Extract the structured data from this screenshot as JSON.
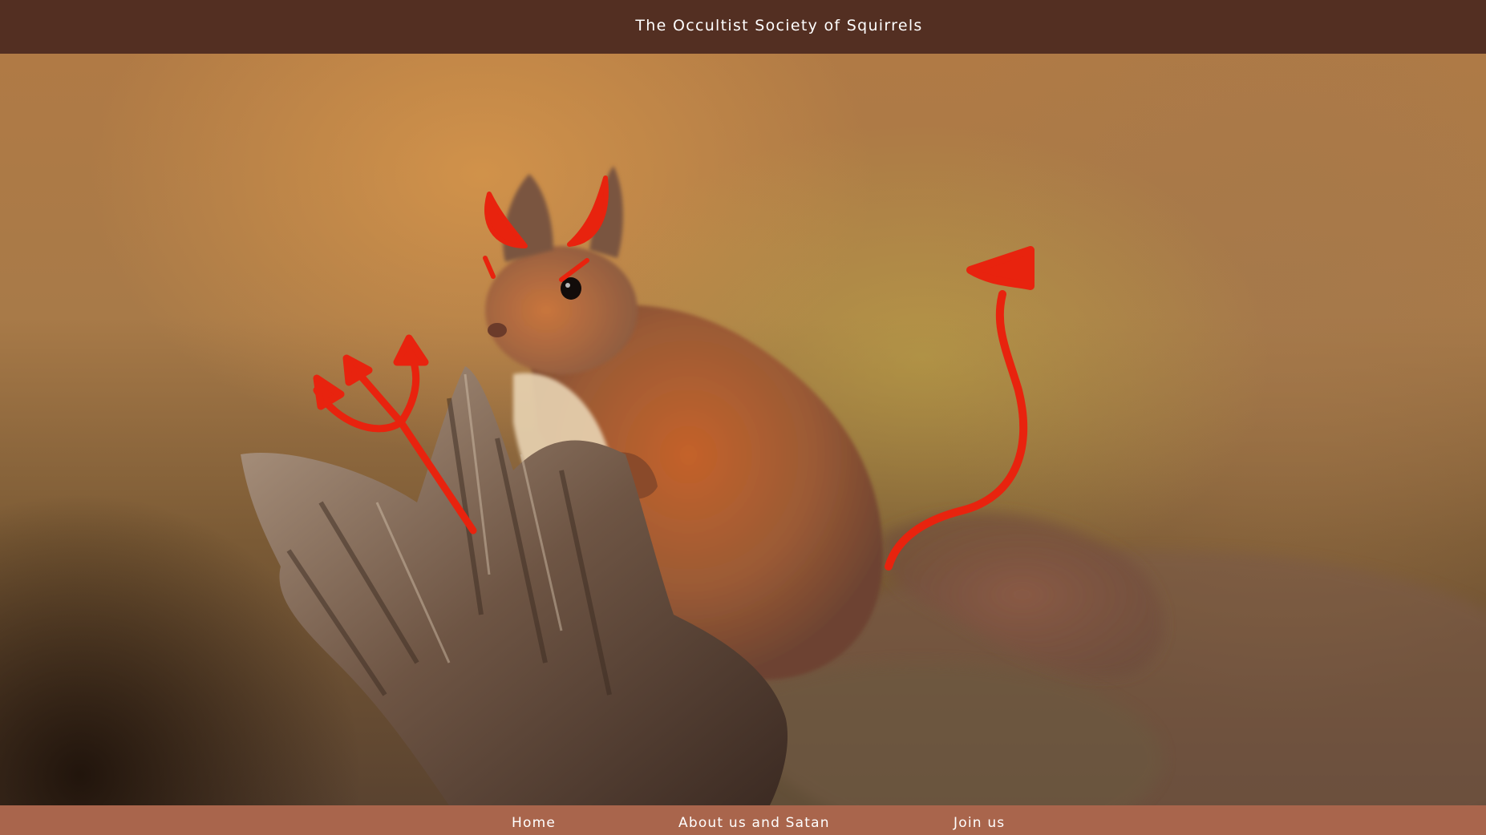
{
  "header": {
    "title": "The Occultist Society of Squirrels"
  },
  "hero": {
    "image": "photo of a red squirrel on a tree stump with hand-drawn red devil horns, pitchfork and tail",
    "accent_color": "#e8230e"
  },
  "nav": {
    "items": [
      {
        "label": "Home"
      },
      {
        "label": "About us and Satan"
      },
      {
        "label": "Join us"
      }
    ]
  },
  "colors": {
    "header_bg": "#532f22",
    "footer_bg": "#a9654c",
    "text": "#ffffff"
  }
}
